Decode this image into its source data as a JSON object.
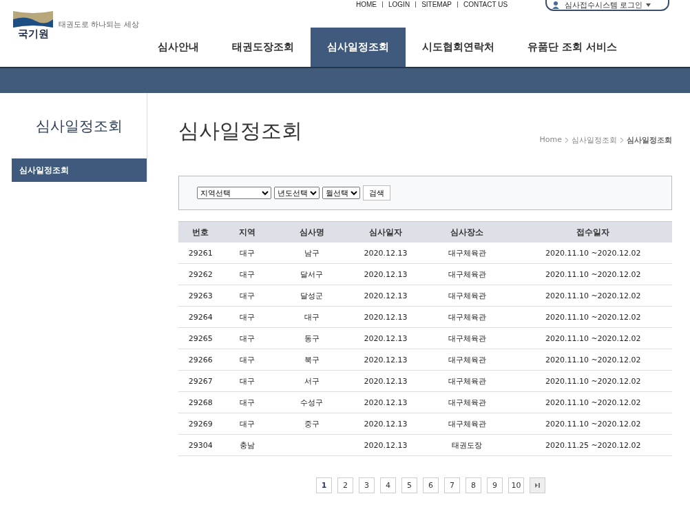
{
  "top_links": [
    "HOME",
    "LOGIN",
    "SITEMAP",
    "CONTACT US"
  ],
  "login_button": {
    "label": "심사접수시스템 로그인"
  },
  "logo": {
    "name": "국기원",
    "tagline": "태권도로 하나되는 세상"
  },
  "nav": [
    {
      "label": "심사안내",
      "selected": false
    },
    {
      "label": "태권도장조회",
      "selected": false
    },
    {
      "label": "심사일정조회",
      "selected": true
    },
    {
      "label": "시도협회연락처",
      "selected": false
    },
    {
      "label": "유품단 조회 서비스",
      "selected": false
    }
  ],
  "sidebar": {
    "title": "심사일정조회",
    "items": [
      {
        "label": "심사일정조회",
        "selected": true
      }
    ]
  },
  "page_title": "심사일정조회",
  "breadcrumb": [
    "Home",
    "심사일정조회",
    "심사일정조회"
  ],
  "filters": {
    "selects": [
      "지역선택",
      "년도선택",
      "월선택"
    ],
    "button": "검색"
  },
  "table": {
    "columns": [
      "번호",
      "지역",
      "심사명",
      "심사일자",
      "심사장소",
      "접수일자"
    ],
    "rows": [
      [
        "29261",
        "대구",
        "남구",
        "2020.12.13",
        "대구체육관",
        "2020.11.10 ~2020.12.02"
      ],
      [
        "29262",
        "대구",
        "달서구",
        "2020.12.13",
        "대구체육관",
        "2020.11.10 ~2020.12.02"
      ],
      [
        "29263",
        "대구",
        "달성군",
        "2020.12.13",
        "대구체육관",
        "2020.11.10 ~2020.12.02"
      ],
      [
        "29264",
        "대구",
        "대구",
        "2020.12.13",
        "대구체육관",
        "2020.11.10 ~2020.12.02"
      ],
      [
        "29265",
        "대구",
        "동구",
        "2020.12.13",
        "대구체육관",
        "2020.11.10 ~2020.12.02"
      ],
      [
        "29266",
        "대구",
        "북구",
        "2020.12.13",
        "대구체육관",
        "2020.11.10 ~2020.12.02"
      ],
      [
        "29267",
        "대구",
        "서구",
        "2020.12.13",
        "대구체육관",
        "2020.11.10 ~2020.12.02"
      ],
      [
        "29268",
        "대구",
        "수성구",
        "2020.12.13",
        "대구체육관",
        "2020.11.10 ~2020.12.02"
      ],
      [
        "29269",
        "대구",
        "중구",
        "2020.12.13",
        "대구체육관",
        "2020.11.10 ~2020.12.02"
      ],
      [
        "29304",
        "충남",
        "",
        "2020.12.13",
        "태권도장",
        "2020.11.25 ~2020.12.02"
      ]
    ]
  },
  "pagination": [
    {
      "label": "1",
      "selected": true
    },
    {
      "label": "2",
      "selected": false
    },
    {
      "label": "3",
      "selected": false
    },
    {
      "label": "4",
      "selected": false
    },
    {
      "label": "5",
      "selected": false
    },
    {
      "label": "6",
      "selected": false
    },
    {
      "label": "7",
      "selected": false
    },
    {
      "label": "8",
      "selected": false
    },
    {
      "label": "9",
      "selected": false
    },
    {
      "label": "10",
      "selected": false
    }
  ]
}
